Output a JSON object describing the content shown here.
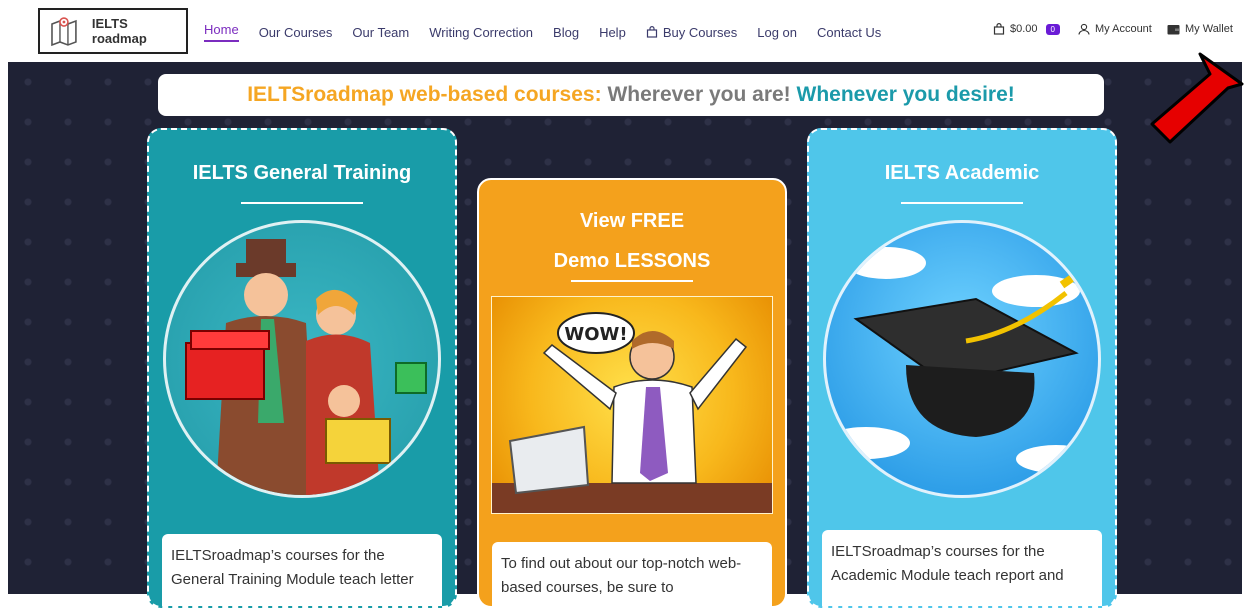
{
  "logo": {
    "text": "IELTS roadmap"
  },
  "nav": {
    "items": [
      {
        "label": "Home"
      },
      {
        "label": "Our Courses"
      },
      {
        "label": "Our Team"
      },
      {
        "label": "Writing Correction"
      },
      {
        "label": "Blog"
      },
      {
        "label": "Help"
      },
      {
        "label": "Buy Courses"
      },
      {
        "label": "Log on"
      },
      {
        "label": "Contact Us"
      }
    ]
  },
  "utility": {
    "cart_total": "$0.00",
    "cart_count": "0",
    "account": "My Account",
    "wallet": "My Wallet"
  },
  "headline": {
    "part1": "IELTSroadmap web-based courses:",
    "part2": "Wherever you are!",
    "part3": "Whenever you desire!"
  },
  "cards": {
    "general": {
      "title": "IELTS General Training",
      "text": "IELTSroadmap’s courses for the General Training Module teach letter"
    },
    "demo": {
      "title_line1": "View FREE",
      "title_line2": "Demo LESSONS",
      "bubble": "WOW!",
      "text": "To find out about our top-notch web-based courses, be sure to"
    },
    "academic": {
      "title": "IELTS Academic",
      "text": "IELTSroadmap’s courses for the Academic Module teach report and"
    }
  },
  "colors": {
    "brand_purple": "#7b2cbf",
    "orange": "#f5a623",
    "teal": "#199ca8",
    "sky": "#4fc6ea",
    "dark_bg": "#1f2235",
    "arrow_red": "#e60000"
  }
}
